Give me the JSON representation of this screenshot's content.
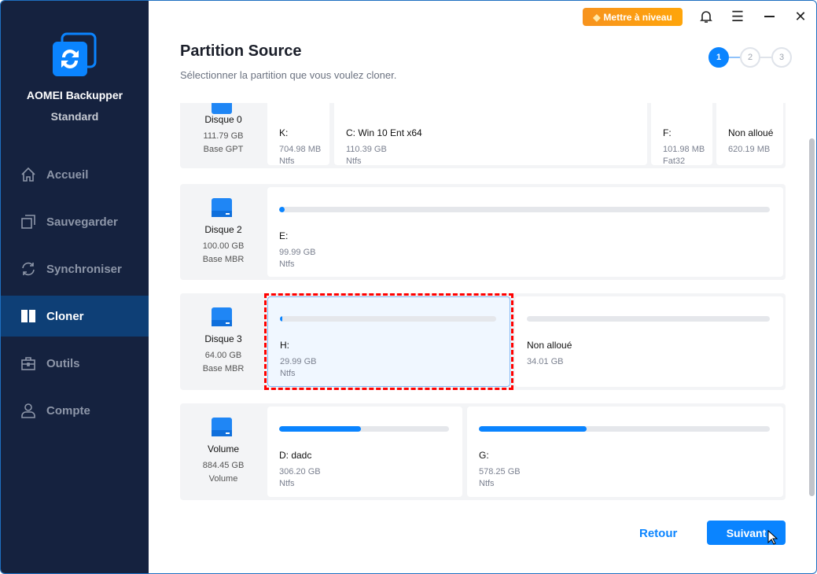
{
  "app": {
    "name": "AOMEI Backupper",
    "edition": "Standard"
  },
  "sidebar": {
    "items": [
      {
        "label": "Accueil",
        "icon": "home-icon"
      },
      {
        "label": "Sauvegarder",
        "icon": "backup-icon"
      },
      {
        "label": "Synchroniser",
        "icon": "sync-icon"
      },
      {
        "label": "Cloner",
        "icon": "clone-icon",
        "active": true
      },
      {
        "label": "Outils",
        "icon": "toolbox-icon"
      },
      {
        "label": "Compte",
        "icon": "user-icon"
      }
    ]
  },
  "topbar": {
    "upgrade_label": "Mettre à niveau"
  },
  "header": {
    "title": "Partition Source",
    "subtitle": "Sélectionner la partition que vous voulez cloner."
  },
  "steps": [
    "1",
    "2",
    "3"
  ],
  "disks": [
    {
      "name": "Disque 0",
      "size": "111.79 GB",
      "type": "Base GPT",
      "partitions": [
        {
          "name": "K:",
          "size": "704.98 MB",
          "fs": "Ntfs"
        },
        {
          "name": "C: Win 10 Ent x64",
          "size": "110.39 GB",
          "fs": "Ntfs"
        },
        {
          "name": "F:",
          "size": "101.98 MB",
          "fs": "Fat32"
        },
        {
          "name": "Non alloué",
          "size": "620.19 MB"
        }
      ]
    },
    {
      "name": "Disque 2",
      "size": "100.00 GB",
      "type": "Base MBR",
      "partitions": [
        {
          "name": "E:",
          "size": "99.99 GB",
          "fs": "Ntfs",
          "used_pct": 1
        }
      ]
    },
    {
      "name": "Disque 3",
      "size": "64.00 GB",
      "type": "Base MBR",
      "partitions": [
        {
          "name": "H:",
          "size": "29.99 GB",
          "fs": "Ntfs",
          "used_pct": 1,
          "selected": true
        },
        {
          "name": "Non alloué",
          "size": "34.01 GB",
          "used_pct": 0
        }
      ]
    },
    {
      "name": "Volume",
      "size": "884.45 GB",
      "type": "Volume",
      "partitions": [
        {
          "name": "D: dadc",
          "size": "306.20 GB",
          "fs": "Ntfs",
          "used_pct": 48
        },
        {
          "name": "G:",
          "size": "578.25 GB",
          "fs": "Ntfs",
          "used_pct": 37
        }
      ]
    }
  ],
  "footer": {
    "back_label": "Retour",
    "next_label": "Suivant"
  }
}
